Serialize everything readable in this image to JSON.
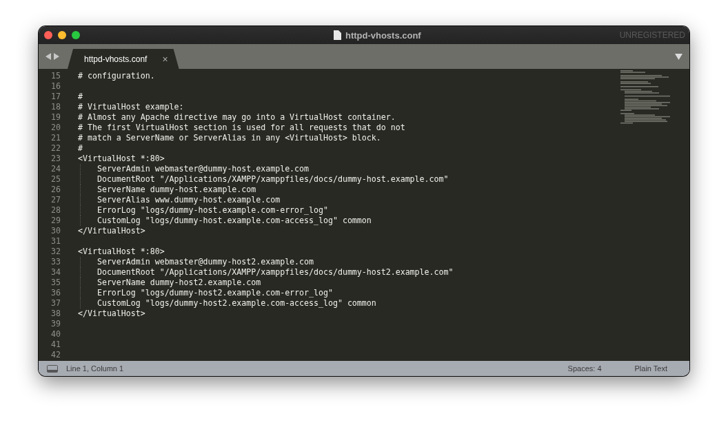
{
  "window": {
    "title": "httpd-vhosts.conf",
    "license_notice": "UNREGISTERED"
  },
  "tabs": [
    {
      "label": "httpd-vhosts.conf",
      "close": "×",
      "selected": true
    }
  ],
  "editor": {
    "lines": [
      {
        "number": "15",
        "text": "# configuration.",
        "guide": false
      },
      {
        "number": "16",
        "guide": false
      },
      {
        "number": "17",
        "text": "#",
        "guide": false
      },
      {
        "number": "18",
        "text": "# VirtualHost example:",
        "guide": false
      },
      {
        "number": "19",
        "text": "# Almost any Apache directive may go into a VirtualHost container.",
        "guide": false
      },
      {
        "number": "20",
        "text": "# The first VirtualHost section is used for all requests that do not",
        "guide": false
      },
      {
        "number": "21",
        "text": "# match a ServerName or ServerAlias in any <VirtualHost> block.",
        "guide": false
      },
      {
        "number": "22",
        "text": "#",
        "guide": false
      },
      {
        "number": "23",
        "text": "<VirtualHost *:80>",
        "guide": false
      },
      {
        "number": "24",
        "text": "    ServerAdmin webmaster@dummy-host.example.com",
        "guide": true
      },
      {
        "number": "25",
        "text": "    DocumentRoot \"/Applications/XAMPP/xamppfiles/docs/dummy-host.example.com\"",
        "guide": true
      },
      {
        "number": "26",
        "text": "    ServerName dummy-host.example.com",
        "guide": true
      },
      {
        "number": "27",
        "text": "    ServerAlias www.dummy-host.example.com",
        "guide": true
      },
      {
        "number": "28",
        "text": "    ErrorLog \"logs/dummy-host.example.com-error_log\"",
        "guide": true
      },
      {
        "number": "29",
        "text": "    CustomLog \"logs/dummy-host.example.com-access_log\" common",
        "guide": true
      },
      {
        "number": "30",
        "text": "</VirtualHost>",
        "guide": false
      },
      {
        "number": "31",
        "guide": false
      },
      {
        "number": "32",
        "text": "<VirtualHost *:80>",
        "guide": false
      },
      {
        "number": "33",
        "text": "    ServerAdmin webmaster@dummy-host2.example.com",
        "guide": true
      },
      {
        "number": "34",
        "text": "    DocumentRoot \"/Applications/XAMPP/xamppfiles/docs/dummy-host2.example.com\"",
        "guide": true
      },
      {
        "number": "35",
        "text": "    ServerName dummy-host2.example.com",
        "guide": true
      },
      {
        "number": "36",
        "text": "    ErrorLog \"logs/dummy-host2.example.com-error_log\"",
        "guide": true
      },
      {
        "number": "37",
        "text": "    CustomLog \"logs/dummy-host2.example.com-access_log\" common",
        "guide": true
      },
      {
        "number": "38",
        "text": "</VirtualHost>",
        "guide": false
      },
      {
        "number": "39",
        "guide": false
      },
      {
        "number": "40",
        "guide": false
      },
      {
        "number": "41",
        "guide": false
      },
      {
        "number": "42",
        "guide": false
      }
    ]
  },
  "status_bar": {
    "position": "Line 1, Column 1",
    "indentation": "Spaces: 4",
    "syntax": "Plain Text"
  }
}
